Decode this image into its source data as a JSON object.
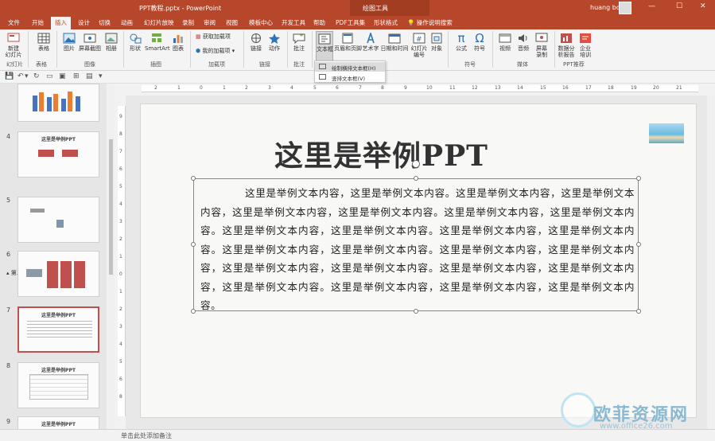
{
  "titlebar": {
    "title": "PPT教程.pptx  -  PowerPoint",
    "context_tool": "绘图工具",
    "user": "huang bo",
    "min": "—",
    "max": "☐",
    "close": "✕"
  },
  "tabs": [
    "文件",
    "开始",
    "插入",
    "设计",
    "切换",
    "动画",
    "幻灯片放映",
    "录制",
    "审阅",
    "视图",
    "模板中心",
    "开发工具",
    "帮助",
    "PDF工具集",
    "形状格式"
  ],
  "active_tab": "插入",
  "tell_me": "操作说明搜索",
  "ribbon": {
    "buttons": [
      "新建\n幻灯片",
      "表格",
      "图片",
      "屏幕截图",
      "相册",
      "形状",
      "SmartArt",
      "图表",
      "获取加载项",
      "我的加载项",
      "链接",
      "动作",
      "批注",
      "文本框",
      "页眉和页脚",
      "艺术字",
      "日期和时间",
      "幻灯片\n编号",
      "对象",
      "公式",
      "符号",
      "视频",
      "音频",
      "屏幕\n录制",
      "数据分\n析报告",
      "企业\n培训"
    ],
    "groups": [
      "幻灯片",
      "表格",
      "图像",
      "插图",
      "加载项",
      "链接",
      "批注",
      "符号",
      "媒体",
      "PPT推荐"
    ]
  },
  "dropdown": {
    "items": [
      "绘制横排文本框(H)",
      "竖排文本框(V)"
    ]
  },
  "thumbnails": [
    {
      "num": "",
      "title": ""
    },
    {
      "num": "4",
      "title": "这里是举例PPT"
    },
    {
      "num": "5",
      "title": ""
    },
    {
      "num": "6",
      "title": ""
    },
    {
      "num": "7",
      "title": "这里是举例PPT"
    },
    {
      "num": "8",
      "title": "这里是举例PPT"
    },
    {
      "num": "9",
      "title": "这里是举例PPT"
    }
  ],
  "section": "第二章",
  "ruler": {
    "h": [
      "2",
      "1",
      "0",
      "1",
      "2",
      "3",
      "4",
      "5",
      "6",
      "7",
      "8",
      "9",
      "10",
      "11",
      "12",
      "13",
      "14",
      "15",
      "16",
      "17",
      "18",
      "19",
      "20",
      "21",
      "22"
    ],
    "v": [
      "9",
      "8",
      "7",
      "6",
      "5",
      "4",
      "3",
      "2",
      "1",
      "0",
      "1",
      "2",
      "3",
      "4",
      "5",
      "6",
      "7",
      "8",
      "9",
      "10"
    ]
  },
  "slide": {
    "title": "这里是举例PPT",
    "body": "这里是举例文本内容，这里是举例文本内容。这里是举例文本内容，这里是举例文本内容，这里是举例文本内容，这里是举例文本内容。这里是举例文本内容，这里是举例文本内容。这里是举例文本内容，这里是举例文本内容。这里是举例文本内容，这里是举例文本内容。这里是举例文本内容，这里是举例文本内容。这里是举例文本内容，这里是举例文本内容，这里是举例文本内容，这里是举例文本内容。这里是举例文本内容，这里是举例文本内容，这里是举例文本内容。这里是举例文本内容，这里是举例文本内容，这里是举例文本内容。"
  },
  "status": {
    "notes": "单击此处添加备注"
  },
  "watermark": {
    "logo": "欧菲资源网",
    "url": "www.office26.com"
  },
  "colors": {
    "accent": "#b7472a",
    "selected": "#c0504d"
  }
}
